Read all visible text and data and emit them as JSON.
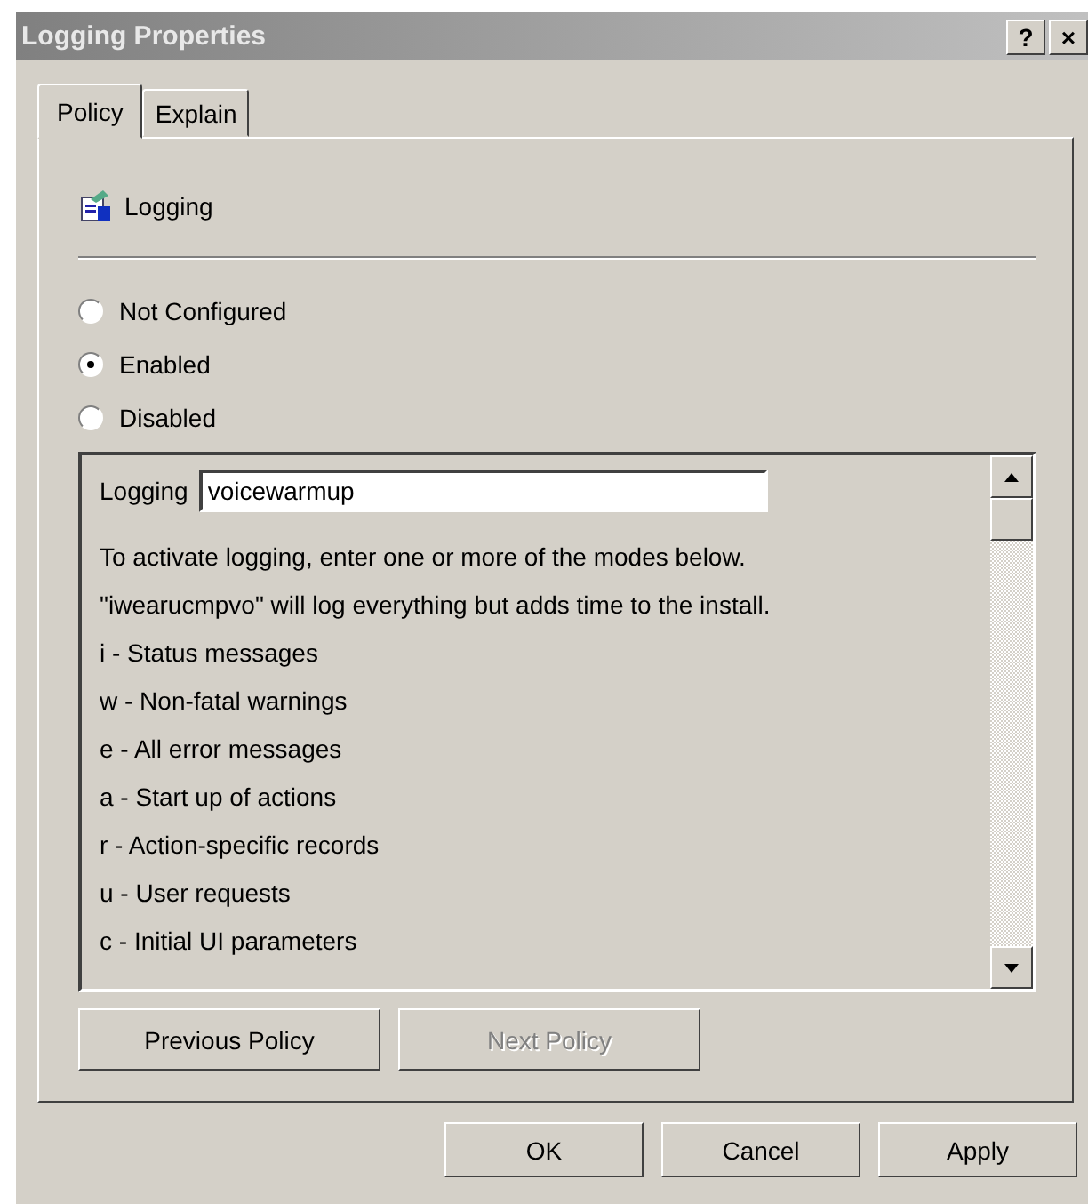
{
  "window": {
    "title": "Logging Properties",
    "title_buttons": [
      "?",
      "×"
    ]
  },
  "tabs": [
    {
      "label": "Policy",
      "selected": true
    },
    {
      "label": "Explain",
      "selected": false
    }
  ],
  "policy": {
    "name": "Logging"
  },
  "options": [
    {
      "label": "Not Configured",
      "selected": false
    },
    {
      "label": "Enabled",
      "selected": true
    },
    {
      "label": "Disabled",
      "selected": false
    }
  ],
  "settings": {
    "field_label": "Logging",
    "field_value": "voicewarmup",
    "lines": [
      "To activate logging, enter one or more of the modes below.",
      "\"iwearucmpvo\" will log everything but adds time to the install.",
      "i - Status messages",
      "w - Non-fatal warnings",
      "e - All error messages",
      "a - Start up of actions",
      "r - Action-specific records",
      "u - User requests",
      "c - Initial UI parameters"
    ]
  },
  "nav_buttons": [
    {
      "label": "Previous Policy",
      "disabled": false
    },
    {
      "label": "Next Policy",
      "disabled": true
    }
  ],
  "buttons": [
    {
      "label": "OK",
      "disabled": false
    },
    {
      "label": "Cancel",
      "disabled": false
    },
    {
      "label": "Apply",
      "disabled": false
    }
  ]
}
